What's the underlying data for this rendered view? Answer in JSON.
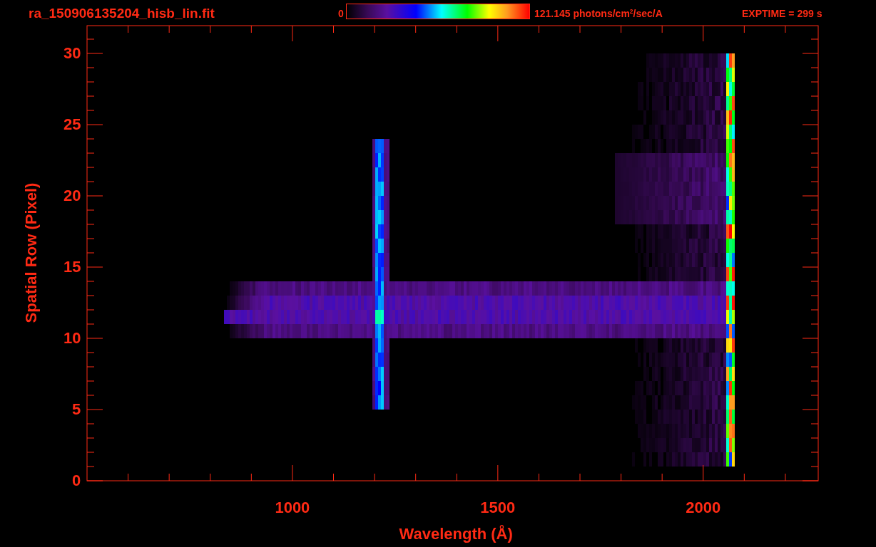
{
  "header": {
    "filename": "ra_150906135204_hisb_lin.fit",
    "colorbar_min": "0",
    "colorbar_max": "121.145 photons/cm$^{2}$/sec/A",
    "exptime": "EXPTIME = 299 s"
  },
  "plot": {
    "ylabel": "Spatial Row (Pixel)",
    "xlabel": "Wavelength (Å)",
    "yticks": [
      "30",
      "25",
      "20",
      "15",
      "10",
      "5",
      "0"
    ],
    "xticks": [
      "1000",
      "1500",
      "2000"
    ]
  }
}
